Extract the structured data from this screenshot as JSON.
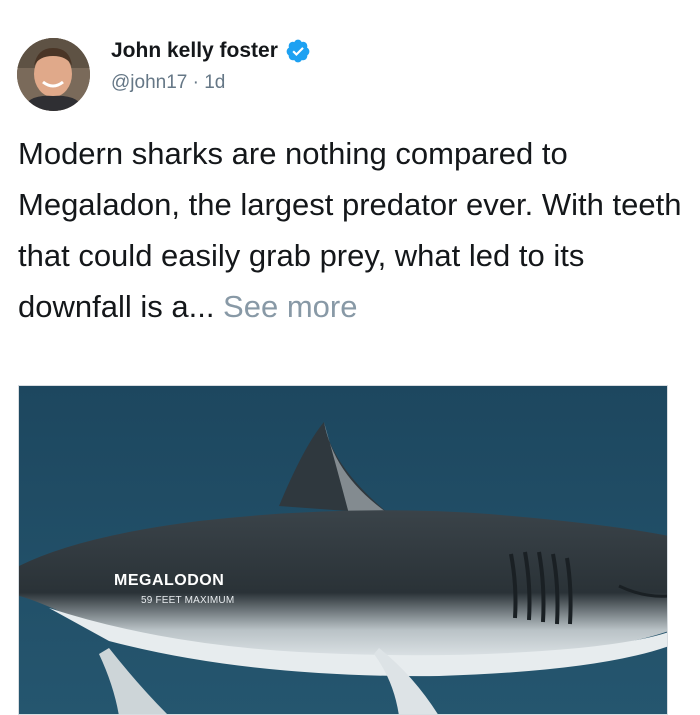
{
  "post": {
    "author": {
      "name": "John kelly foster",
      "handle": "@john17",
      "separator": " · ",
      "time": "1d",
      "verified": true,
      "avatar_icon": "profile-photo"
    },
    "text": "Modern sharks are nothing compared to Megaladon, the largest predator ever. With teeth that could easily grab prey, what led to its downfall is a... ",
    "see_more": "See more",
    "media": {
      "title": "MEGALODON",
      "subtitle": "59 FEET MAXIMUM",
      "background_color": "#1f4a63"
    }
  },
  "colors": {
    "verified_badge": "#1da1f2",
    "secondary_text": "#657786",
    "see_more": "#8899a6"
  }
}
